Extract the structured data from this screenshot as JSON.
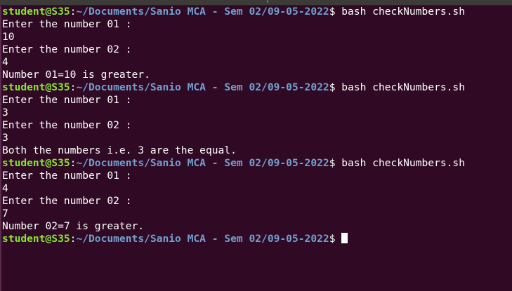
{
  "terminal": {
    "prompt": {
      "user_host": "student@S35",
      "sep": ":",
      "path": "~/Documents/Sanio MCA - Sem 02/09-05-2022",
      "symbol": "$"
    },
    "lines": [
      {
        "type": "prompt",
        "command": " bash checkNumbers.sh"
      },
      {
        "type": "output",
        "text": "Enter the number 01 :"
      },
      {
        "type": "output",
        "text": "10"
      },
      {
        "type": "output",
        "text": "Enter the number 02 :"
      },
      {
        "type": "output",
        "text": "4"
      },
      {
        "type": "output",
        "text": "Number 01=10 is greater."
      },
      {
        "type": "prompt",
        "command": " bash checkNumbers.sh"
      },
      {
        "type": "output",
        "text": "Enter the number 01 :"
      },
      {
        "type": "output",
        "text": "3"
      },
      {
        "type": "output",
        "text": "Enter the number 02 :"
      },
      {
        "type": "output",
        "text": "3"
      },
      {
        "type": "output",
        "text": "Both the numbers i.e. 3 are the equal."
      },
      {
        "type": "prompt",
        "command": " bash checkNumbers.sh"
      },
      {
        "type": "output",
        "text": "Enter the number 01 :"
      },
      {
        "type": "output",
        "text": "4"
      },
      {
        "type": "output",
        "text": "Enter the number 02 :"
      },
      {
        "type": "output",
        "text": "7"
      },
      {
        "type": "output",
        "text": "Number 02=7 is greater."
      },
      {
        "type": "prompt",
        "command": "",
        "cursor": true
      }
    ]
  },
  "colors": {
    "background": "#300a24",
    "user_host": "#8ae234",
    "path": "#729fcf",
    "text": "#ffffff"
  }
}
